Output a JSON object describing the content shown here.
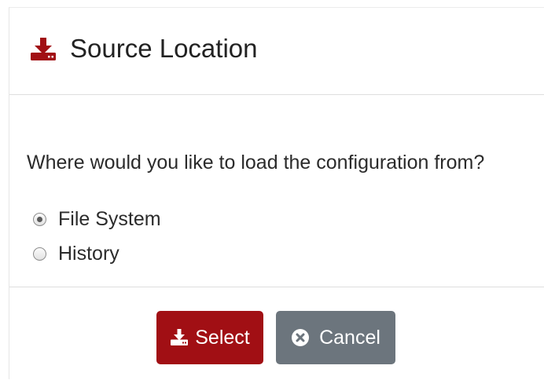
{
  "dialog": {
    "title": "Source Location",
    "title_icon": "download-icon",
    "question": "Where would you like to load the configuration from?",
    "options": [
      {
        "label": "File System",
        "checked": true
      },
      {
        "label": "History",
        "checked": false
      }
    ],
    "buttons": {
      "select_label": "Select",
      "select_icon": "download-icon",
      "cancel_label": "Cancel",
      "cancel_icon": "times-circle-icon"
    },
    "colors": {
      "accent": "#a10f14",
      "cancel": "#6c757d"
    }
  }
}
